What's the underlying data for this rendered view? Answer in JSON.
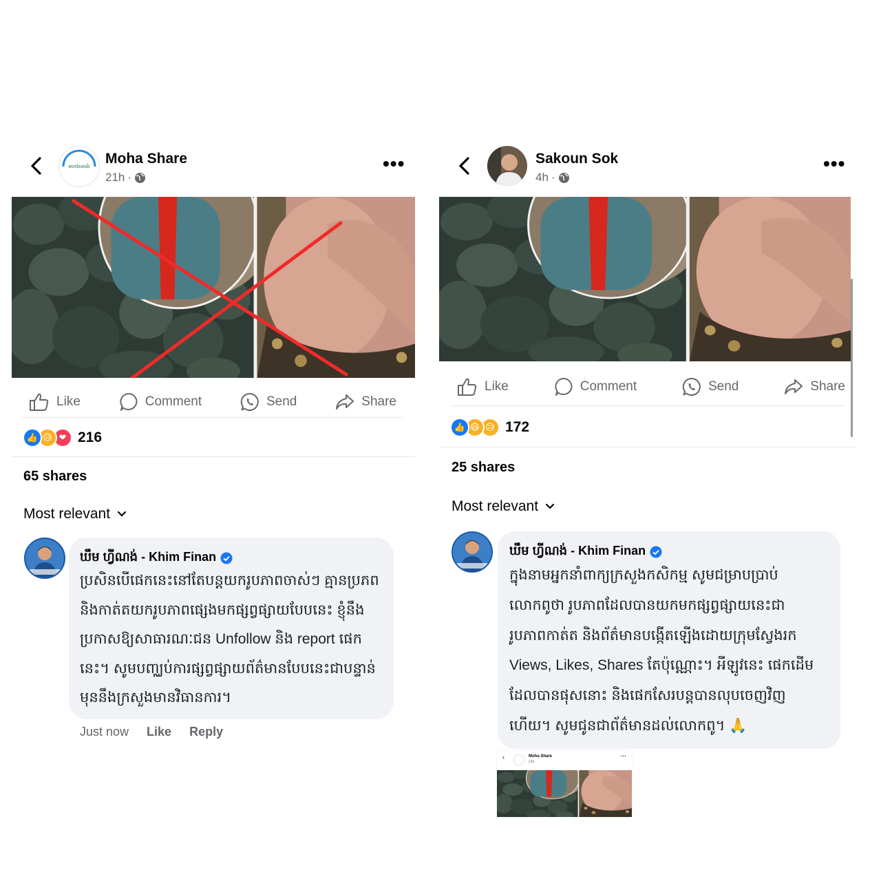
{
  "posts": [
    {
      "author": "Moha Share",
      "avatar_text": "មហាសែរឃ័រ",
      "time": "21h",
      "actions": {
        "like": "Like",
        "comment": "Comment",
        "send": "Send",
        "share": "Share"
      },
      "reaction_count": "216",
      "shares": "65 shares",
      "sort": "Most relevant",
      "comment": {
        "author": "ឃឹម ហ្វីណង់ - Khim Finan",
        "lines": [
          "ប្រសិនបើផេកនេះនៅតែបន្តយករូបភាពចាស់ៗ គ្មានប្រភព",
          "និងកាត់តយករូបភាពផ្សេងមកផ្សព្វផ្សាយបែបនេះ ខ្ញុំនឹង",
          "ប្រកាសឱ្យសាធារណៈជន Unfollow និង report ផេក",
          "នេះ។ សូមបញ្ឈប់ការផ្សព្វផ្សាយព័ត៌មានបែបនេះជាបន្ទាន់",
          "មុននឹងក្រសួងមានវិធានការ។"
        ],
        "footer": {
          "time": "Just now",
          "like": "Like",
          "reply": "Reply"
        }
      }
    },
    {
      "author": "Sakoun Sok",
      "time": "4h",
      "actions": {
        "like": "Like",
        "comment": "Comment",
        "send": "Send",
        "share": "Share"
      },
      "reaction_count": "172",
      "shares": "25 shares",
      "sort": "Most relevant",
      "comment": {
        "author": "ឃឹម ហ្វីណង់ - Khim Finan",
        "lines": [
          "ក្នុងនាមអ្នកនាំពាក្យក្រសួងកសិកម្ម សូមជម្រាបប្រាប់",
          "លោកពូថា រូបភាពដែលបានយកមកផ្សព្វផ្សាយនេះជា",
          "រូបភាពកាត់ត និងព័ត៌មានបង្កើតឡើងដោយក្រុមស្វែងរក",
          "Views, Likes, Shares តែប៉ុណ្ណោះ។ អីឡូវនេះ ផេកដើម",
          "ដែលបានផុសនោះ និងផេកសែរបន្តបានលុបចេញវិញ",
          "ហើយ។ សូមជូនជាព័ត៌មានដល់លោកពូ។ 🙏"
        ],
        "thumbnail": {
          "author": "Moha Share",
          "time": "21h ·"
        }
      }
    }
  ],
  "colors": {
    "like_blue": "#1877f2",
    "love_red": "#f33e58",
    "haha_yellow": "#f7b125",
    "muted": "#65676b",
    "bubble": "#f0f2f5",
    "x_mark": "#ee2b2b"
  }
}
